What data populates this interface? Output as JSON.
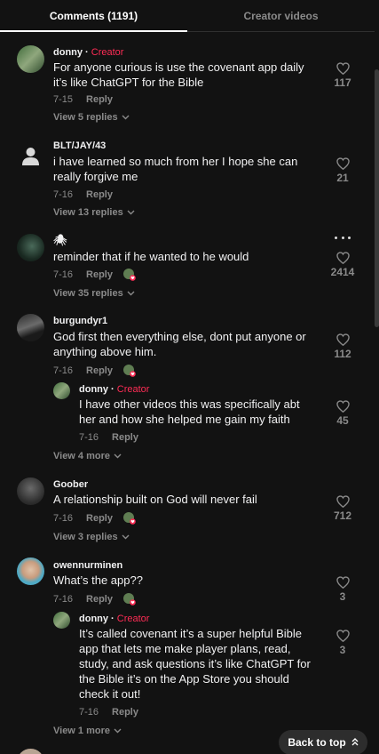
{
  "tabs": {
    "comments": "Comments (1191)",
    "creator_videos": "Creator videos"
  },
  "labels": {
    "reply": "Reply",
    "creator": "Creator",
    "separator": " · ",
    "back_to_top": "Back to top",
    "back_to_top_icon": "double-chevron-up-icon"
  },
  "comments": [
    {
      "username": "donny",
      "is_creator": true,
      "text": "For anyone curious is use the covenant app daily it’s like ChatGPT for the Bible",
      "date": "7-15",
      "likes": "117",
      "view_replies": "View 5 replies"
    },
    {
      "username": "BLT/JAY/43",
      "text": "i have learned so much from her I hope she can really forgive me",
      "date": "7-16",
      "likes": "21",
      "view_replies": "View 13 replies"
    },
    {
      "username": "🕷",
      "text": "reminder that if he wanted to he would",
      "date": "7-16",
      "likes": "2414",
      "view_replies": "View 35 replies",
      "creator_liked": true
    },
    {
      "username": "burgundyr1",
      "text": "God first then everything else, dont put anyone or anything above him.",
      "date": "7-16",
      "likes": "112",
      "creator_liked": true,
      "reply": {
        "username": "donny",
        "is_creator": true,
        "text": "I have other videos this was specifically abt her and how she helped me gain my faith",
        "date": "7-16",
        "likes": "45"
      },
      "view_more": "View 4 more"
    },
    {
      "username": "Goober",
      "text": "A relationship built on God will never fail",
      "date": "7-16",
      "likes": "712",
      "view_replies": "View 3 replies",
      "creator_liked": true
    },
    {
      "username": "owennurminen",
      "text": "What’s the app??",
      "date": "7-16",
      "likes": "3",
      "creator_liked": true,
      "reply": {
        "username": "donny",
        "is_creator": true,
        "text": "It’s called covenant it’s a super helpful Bible app that lets me make player plans, read, study, and ask questions it’s like ChatGPT for the Bible it’s on the App Store you should check it out!",
        "date": "7-16",
        "likes": "3"
      },
      "view_more": "View 1 more"
    }
  ]
}
